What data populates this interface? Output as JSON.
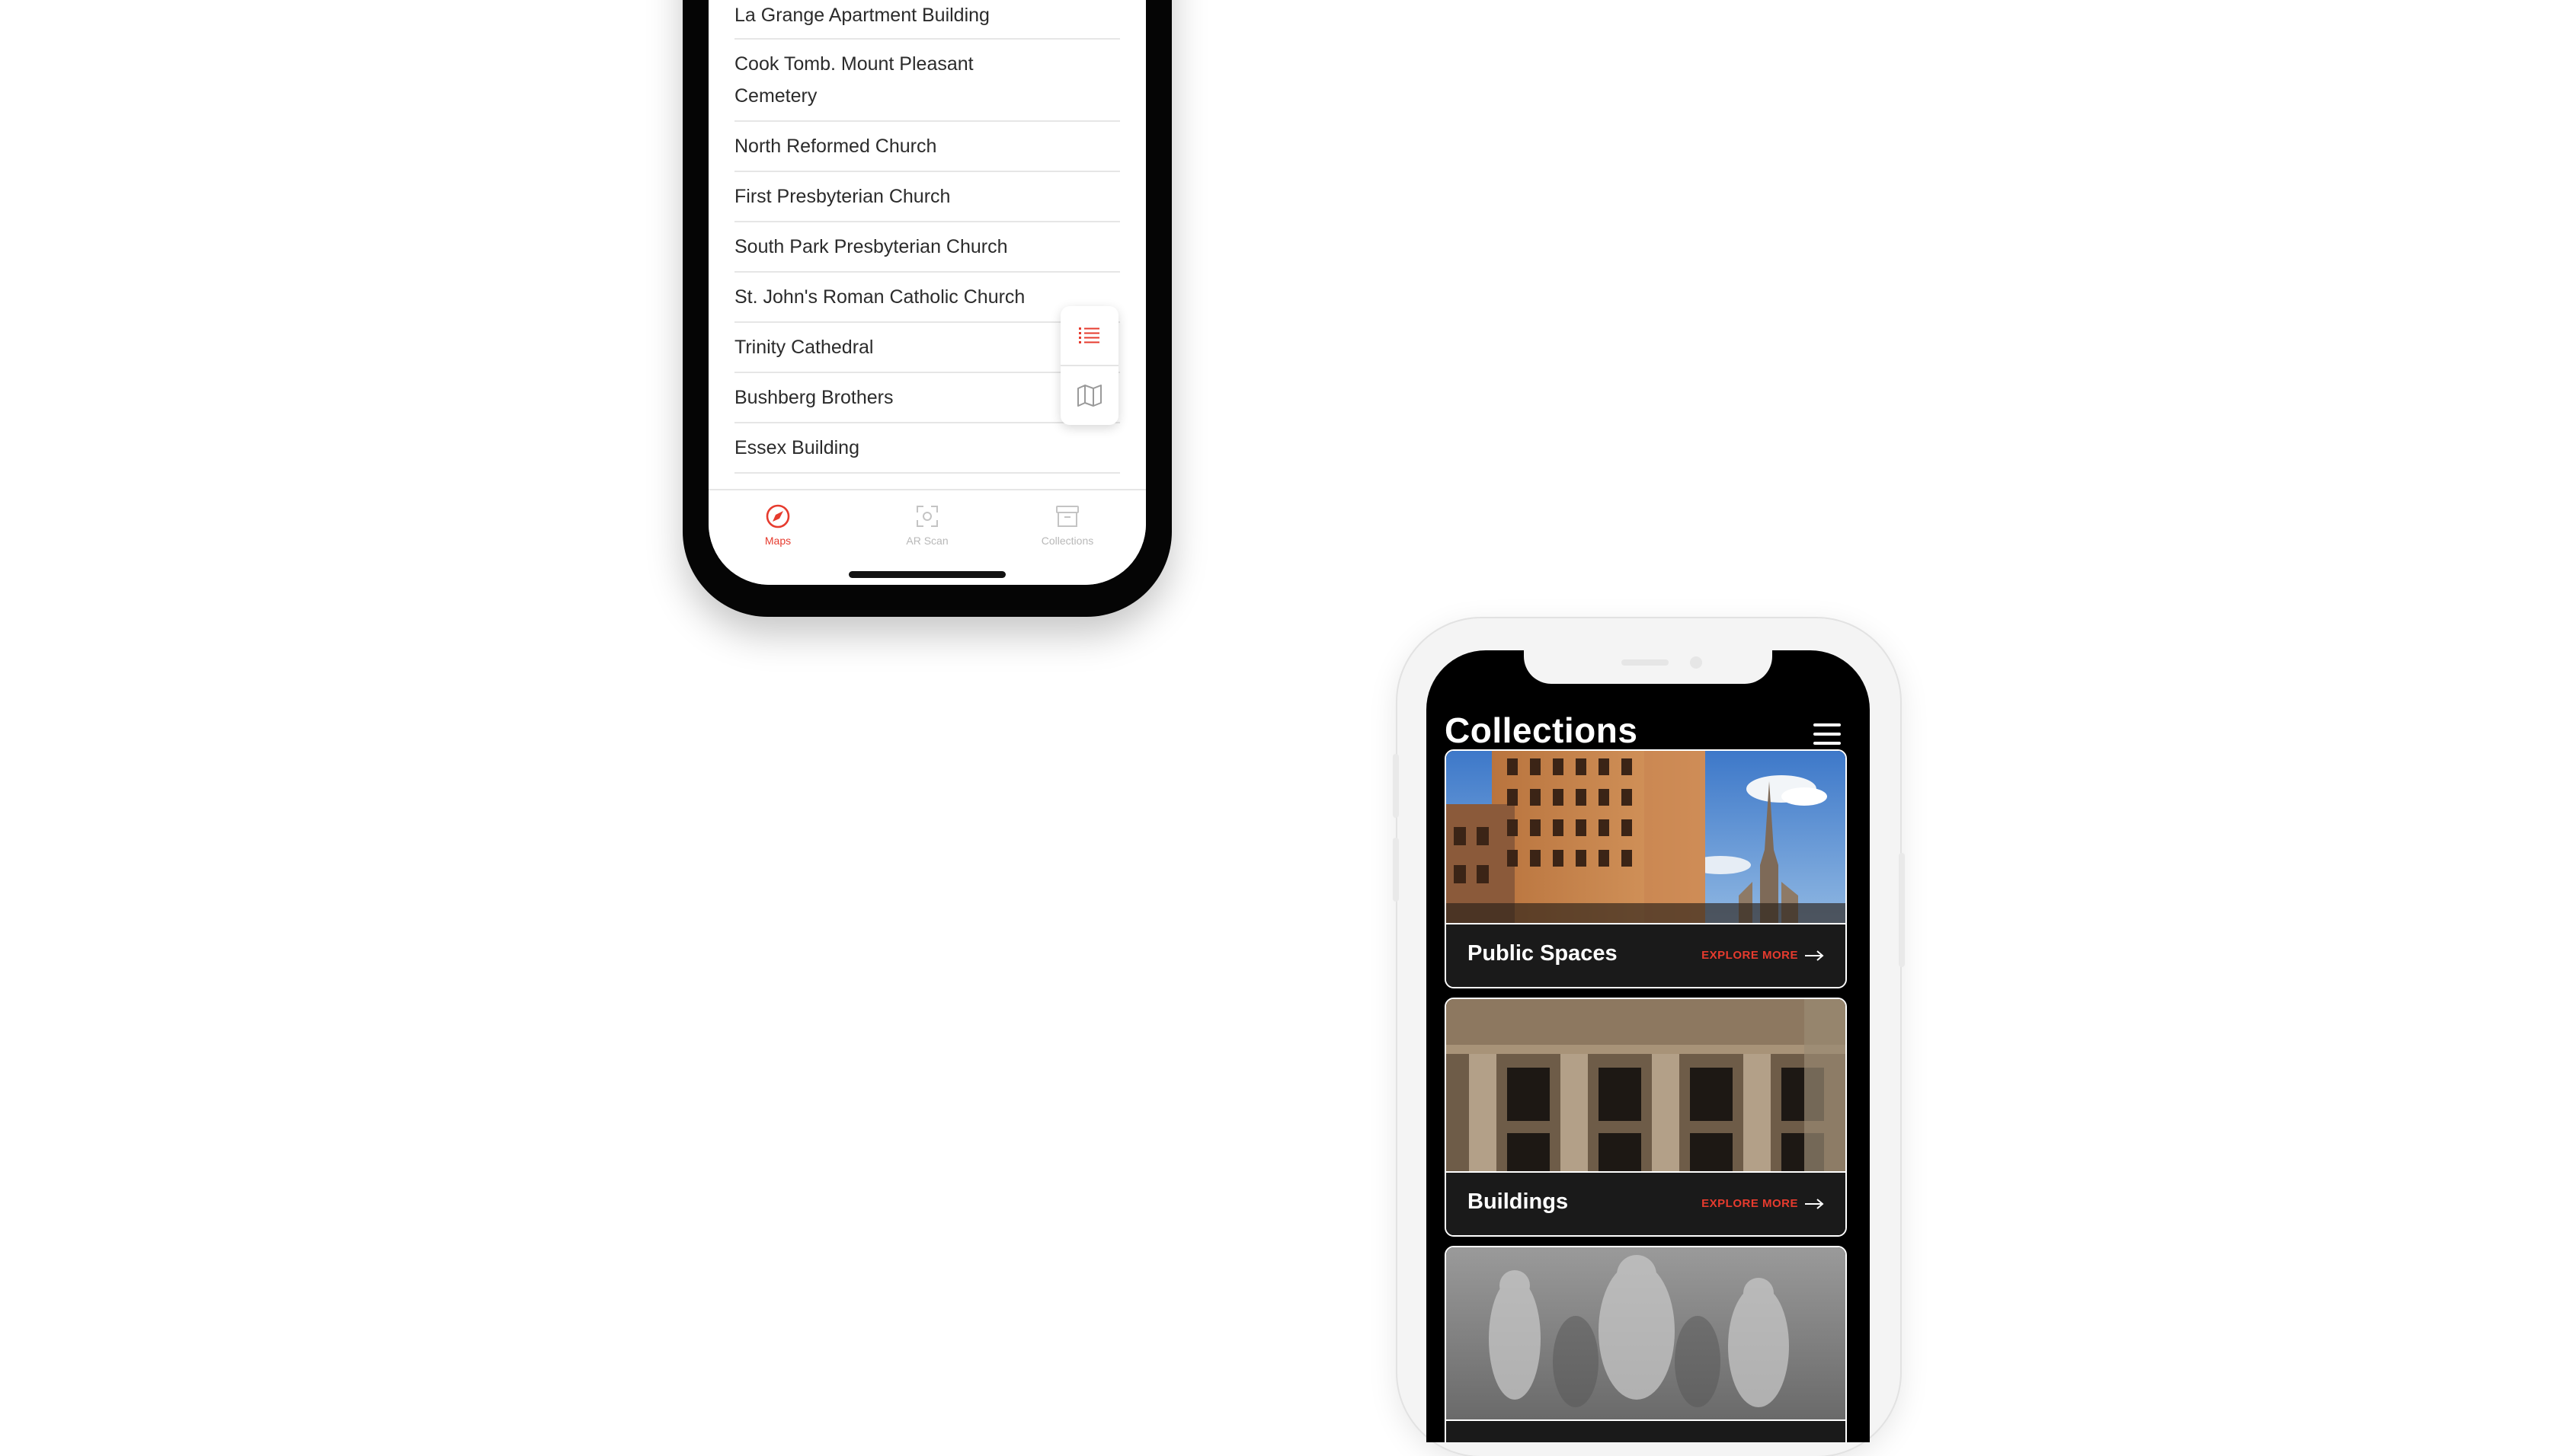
{
  "list_screen": {
    "items": [
      "La Grange Apartment Building",
      "Cook Tomb. Mount Pleasant Cemetery",
      "North Reformed Church",
      "First Presbyterian Church",
      "South Park Presbyterian Church",
      "St. John's Roman Catholic Church",
      "Trinity Cathedral",
      "Bushberg Brothers",
      "Essex Building"
    ],
    "view_toggle": {
      "list_icon": "list-icon",
      "map_icon": "map-icon"
    },
    "tabs": [
      {
        "label": "Maps",
        "icon": "compass-icon",
        "active": true
      },
      {
        "label": "AR Scan",
        "icon": "scan-icon",
        "active": false
      },
      {
        "label": "Collections",
        "icon": "archive-icon",
        "active": false
      }
    ],
    "colors": {
      "accent": "#e63b2e",
      "inactive": "#b8b8b8",
      "divider": "#e6e6e6"
    }
  },
  "collections_screen": {
    "title": "Collections",
    "menu_icon": "hamburger-menu-icon",
    "cards": [
      {
        "title": "Public Spaces",
        "cta": "EXPLORE MORE"
      },
      {
        "title": "Buildings",
        "cta": "EXPLORE MORE"
      },
      {
        "title": "",
        "cta": ""
      }
    ],
    "colors": {
      "background": "#000000",
      "accent": "#e63b2e",
      "text": "#ffffff"
    }
  }
}
